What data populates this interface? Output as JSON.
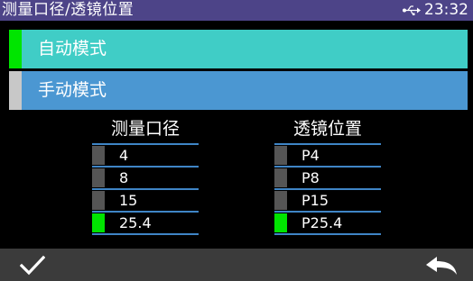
{
  "header": {
    "title": "测量口径/透镜位置",
    "clock": "23:32",
    "usb_icon": "usb-icon"
  },
  "modes": [
    {
      "label": "自动模式",
      "selected": true
    },
    {
      "label": "手动模式",
      "selected": false
    }
  ],
  "aperture": {
    "header": "测量口径",
    "options": [
      "4",
      "8",
      "15",
      "25.4"
    ],
    "selected": "25.4"
  },
  "lens_position": {
    "header": "透镜位置",
    "options": [
      "P4",
      "P8",
      "P15",
      "P25.4"
    ],
    "selected": "P25.4"
  },
  "footer": {
    "confirm_icon": "check-icon",
    "back_icon": "return-arrow-icon"
  },
  "colors": {
    "title_bar": "#4d4488",
    "auto_mode": "#40cdc6",
    "manual_mode": "#4b97d2",
    "indicator_active": "#00e400",
    "indicator_inactive": "#555555",
    "divider": "#3f85c6",
    "bottom_bar": "#3b3b3b"
  }
}
